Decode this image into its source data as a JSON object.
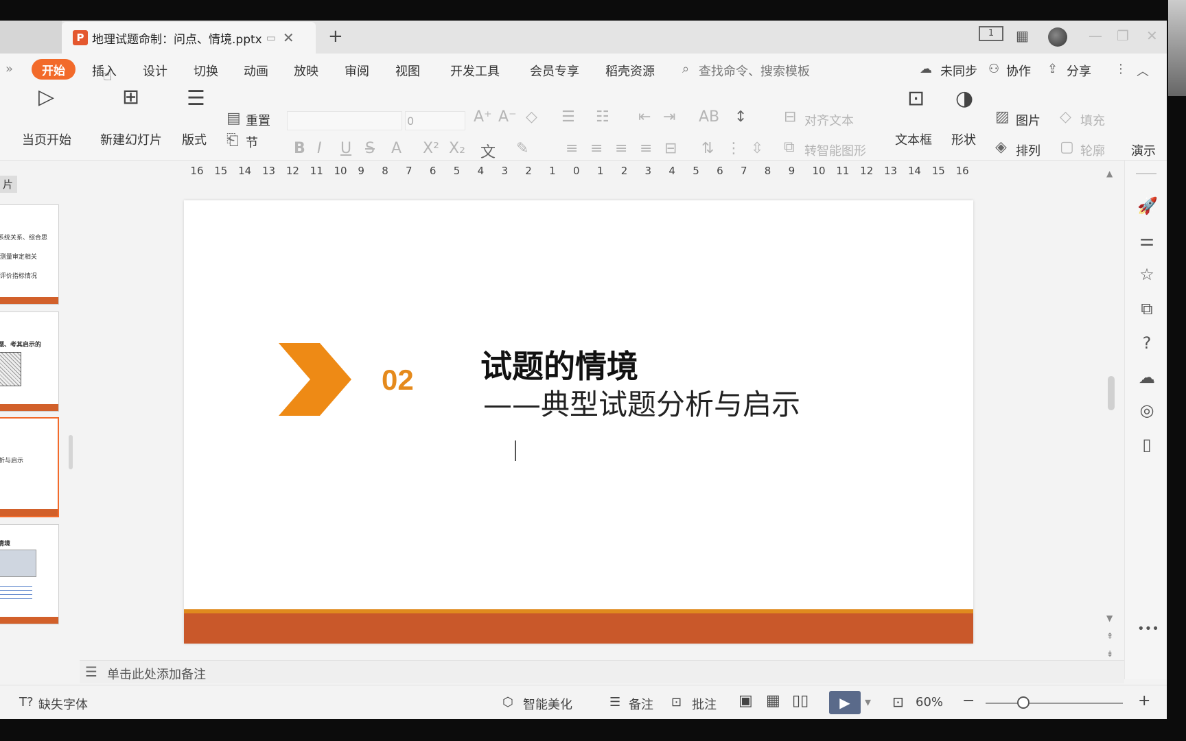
{
  "titlebar": {
    "tab_title": "地理试题命制：问点、情境.pptx",
    "tab_icon_letter": "P",
    "new_tab": "+",
    "layout_badge": "1"
  },
  "menu": {
    "items": [
      "开始",
      "插入",
      "设计",
      "切换",
      "动画",
      "放映",
      "审阅",
      "视图",
      "开发工具",
      "会员专享",
      "稻壳资源"
    ],
    "search_placeholder": "查找命令、搜索模板",
    "unsynced": "未同步",
    "collaborate": "协作",
    "share": "分享"
  },
  "toolbar": {
    "play_current": "当页开始",
    "new_slide": "新建幻灯片",
    "layout": "版式",
    "section": "节",
    "reset": "重置",
    "font_size": "0",
    "align_text": "对齐文本",
    "smart_art": "转智能图形",
    "textbox": "文本框",
    "shape": "形状",
    "picture": "图片",
    "arrange": "排列",
    "fill": "填充",
    "outline": "轮廓",
    "presentation_tools": "演示"
  },
  "thumbnails": {
    "panel_label": "片",
    "slide1_lines": [
      "系统关系、综合思",
      "·测量审定相关",
      "·评价指标情况"
    ],
    "slide2_line": "题、考其启示的",
    "slide3_line": "析与启示",
    "slide4_line": "情境"
  },
  "ruler": {
    "labels": [
      "16",
      "15",
      "14",
      "13",
      "12",
      "11",
      "10",
      "9",
      "8",
      "7",
      "6",
      "5",
      "4",
      "3",
      "2",
      "1",
      "0",
      "1",
      "2",
      "3",
      "4",
      "5",
      "6",
      "7",
      "8",
      "9",
      "10",
      "11",
      "12",
      "13",
      "14",
      "15",
      "16"
    ]
  },
  "slide": {
    "number": "02",
    "title": "试题的情境",
    "subtitle": "——典型试题分析与启示"
  },
  "notes": {
    "placeholder": "单击此处添加备注"
  },
  "statusbar": {
    "missing_font": "缺失字体",
    "smart_beautify": "智能美化",
    "notes": "备注",
    "comment": "批注",
    "zoom": "60%"
  },
  "colors": {
    "accent_orange": "#f26a2a",
    "slide_orange": "#e58a1c",
    "footer_band": "#c9582a"
  }
}
